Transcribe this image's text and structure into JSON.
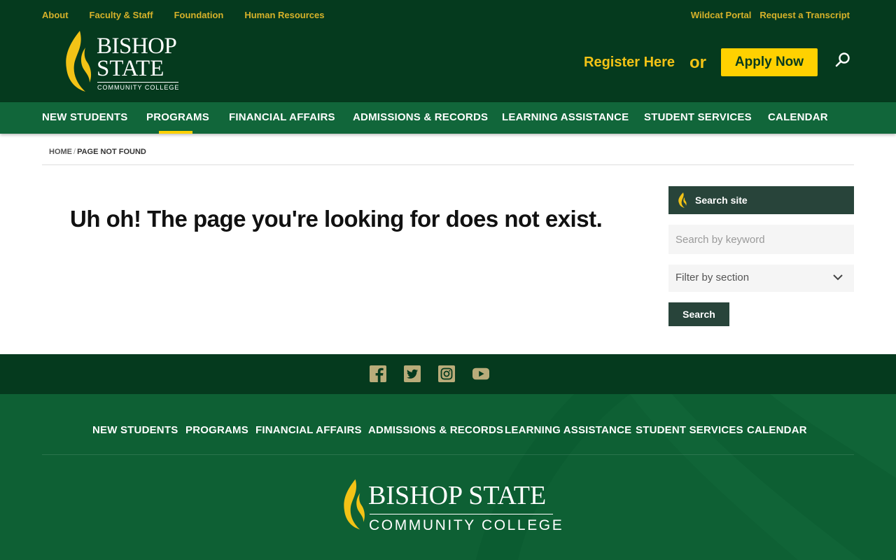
{
  "utility_nav": {
    "left": [
      "About",
      "Faculty & Staff",
      "Foundation",
      "Human Resources"
    ],
    "right": [
      "Wildcat Portal",
      "Request a Transcript"
    ]
  },
  "logo": {
    "line1": "BISHOP",
    "line2": "STATE",
    "subline": "COMMUNITY COLLEGE"
  },
  "cta": {
    "register": "Register Here",
    "or": "or",
    "apply": "Apply Now"
  },
  "main_nav": [
    "NEW STUDENTS",
    "PROGRAMS",
    "FINANCIAL AFFAIRS",
    "ADMISSIONS & RECORDS",
    "LEARNING ASSISTANCE",
    "STUDENT SERVICES",
    "CALENDAR"
  ],
  "breadcrumb": {
    "home": "HOME",
    "separator": "/",
    "current": "PAGE NOT FOUND"
  },
  "main": {
    "heading": "Uh oh! The page you're looking for does not exist."
  },
  "sidebar": {
    "title": "Search site",
    "search_placeholder": "Search by keyword",
    "filter_label": "Filter by section",
    "search_button": "Search"
  },
  "social": [
    "facebook-icon",
    "twitter-icon",
    "instagram-icon",
    "youtube-icon"
  ],
  "footer_nav": [
    "NEW STUDENTS",
    "PROGRAMS",
    "FINANCIAL AFFAIRS",
    "ADMISSIONS & RECORDS",
    "LEARNING ASSISTANCE",
    "STUDENT SERVICES",
    "CALENDAR"
  ],
  "footer_logo": {
    "main": "BISHOP STATE",
    "sub": "COMMUNITY COLLEGE"
  },
  "colors": {
    "dark_green": "#053A1E",
    "nav_green": "#11663A",
    "footer_green": "#0E6034",
    "gold": "#FFD100",
    "gold_text": "#D7B22A",
    "sidebar_green": "#28443A"
  }
}
